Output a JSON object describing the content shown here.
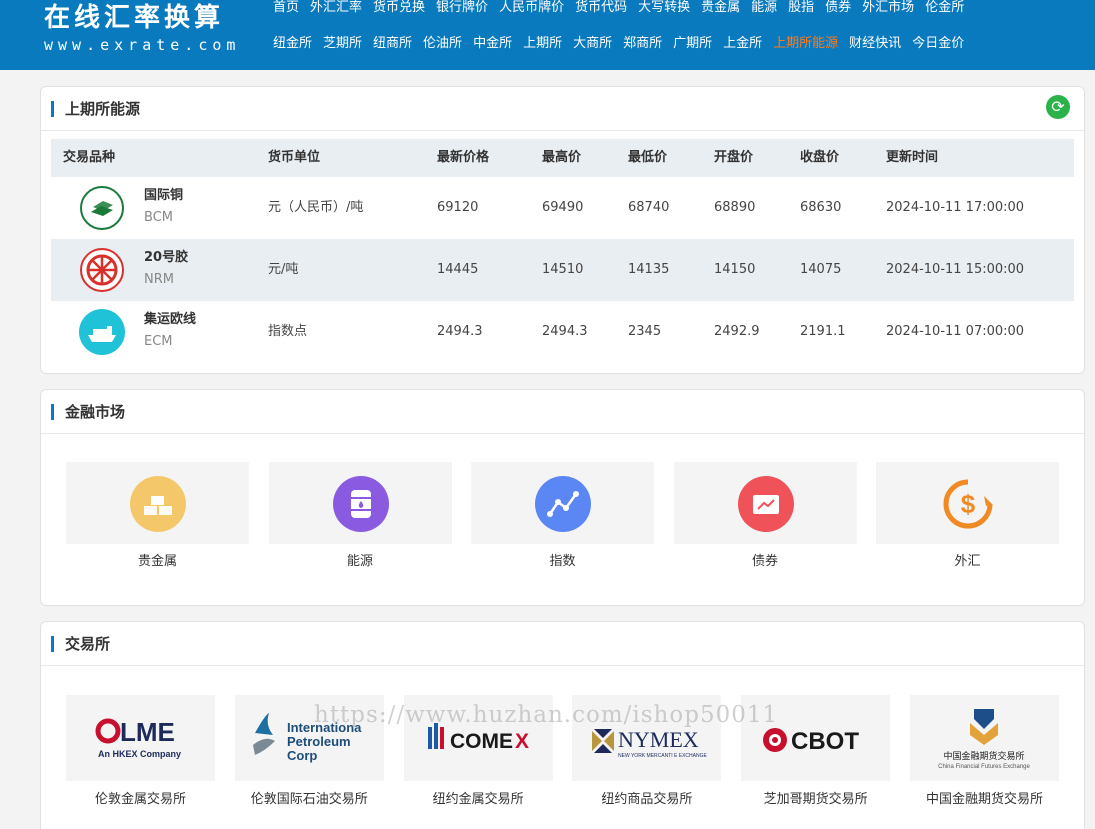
{
  "header": {
    "logo_title": "在线汇率换算",
    "logo_url": "www.exrate.com",
    "nav_row1": [
      "首页",
      "外汇汇率",
      "货币兑换",
      "银行牌价",
      "人民币牌价",
      "货币代码",
      "大写转换",
      "贵金属",
      "能源",
      "股指",
      "债券",
      "外汇市场",
      "伦金所"
    ],
    "nav_row2": [
      "纽金所",
      "芝期所",
      "纽商所",
      "伦油所",
      "中金所",
      "上期所",
      "大商所",
      "郑商所",
      "广期所",
      "上金所",
      "上期所能源",
      "财经快讯",
      "今日金价"
    ],
    "active_item": "上期所能源"
  },
  "energy": {
    "title": "上期所能源",
    "refresh_icon": "refresh-icon",
    "columns": [
      "交易品种",
      "货币单位",
      "最新价格",
      "最高价",
      "最低价",
      "开盘价",
      "收盘价",
      "更新时间"
    ],
    "rows": [
      {
        "name": "国际铜",
        "code": "BCM",
        "unit": "元（人民币）/吨",
        "latest": "69120",
        "high": "69490",
        "low": "68740",
        "open": "68890",
        "close": "68630",
        "time": "2024-10-11 17:00:00",
        "icon": "copper-bars-icon",
        "color": "#1a7a3a"
      },
      {
        "name": "20号胶",
        "code": "NRM",
        "unit": "元/吨",
        "latest": "14445",
        "high": "14510",
        "low": "14135",
        "open": "14150",
        "close": "14075",
        "time": "2024-10-11 15:00:00",
        "icon": "rubber-wheel-icon",
        "color": "#d9302b"
      },
      {
        "name": "集运欧线",
        "code": "ECM",
        "unit": "指数点",
        "latest": "2494.3",
        "high": "2494.3",
        "low": "2345",
        "open": "2492.9",
        "close": "2191.1",
        "time": "2024-10-11 07:00:00",
        "icon": "ship-icon",
        "color": "#1fc2d6"
      }
    ]
  },
  "finance": {
    "title": "金融市场",
    "items": [
      {
        "label": "贵金属",
        "icon": "gold-bars-icon",
        "color": "#f4c86a"
      },
      {
        "label": "能源",
        "icon": "oil-barrel-icon",
        "color": "#8a5be0"
      },
      {
        "label": "指数",
        "icon": "trend-chart-icon",
        "color": "#5b87f5"
      },
      {
        "label": "债券",
        "icon": "bond-certificate-icon",
        "color": "#f0525a"
      },
      {
        "label": "外汇",
        "icon": "dollar-exchange-icon",
        "color": "#f08a24"
      }
    ]
  },
  "exchanges": {
    "title": "交易所",
    "items": [
      {
        "label": "伦敦金属交易所",
        "logo_main": "LME",
        "logo_sub": "An HKEX Company"
      },
      {
        "label": "伦敦国际石油交易所",
        "logo_main": "Internationa",
        "logo_line2": "Petroleum",
        "logo_line3": "Corp"
      },
      {
        "label": "纽约金属交易所",
        "logo_main": "COMEX"
      },
      {
        "label": "纽约商品交易所",
        "logo_main": "NYMEX",
        "logo_sub": "NEW YORK MERCANTI E EXCHANGE"
      },
      {
        "label": "芝加哥期货交易所",
        "logo_main": "CBOT"
      },
      {
        "label": "中国金融期货交易所",
        "logo_main": "中国金融期货交易所",
        "logo_sub": "China Financial Futures Exchange"
      }
    ]
  },
  "watermark": "https://www.huzhan.com/ishop50011"
}
